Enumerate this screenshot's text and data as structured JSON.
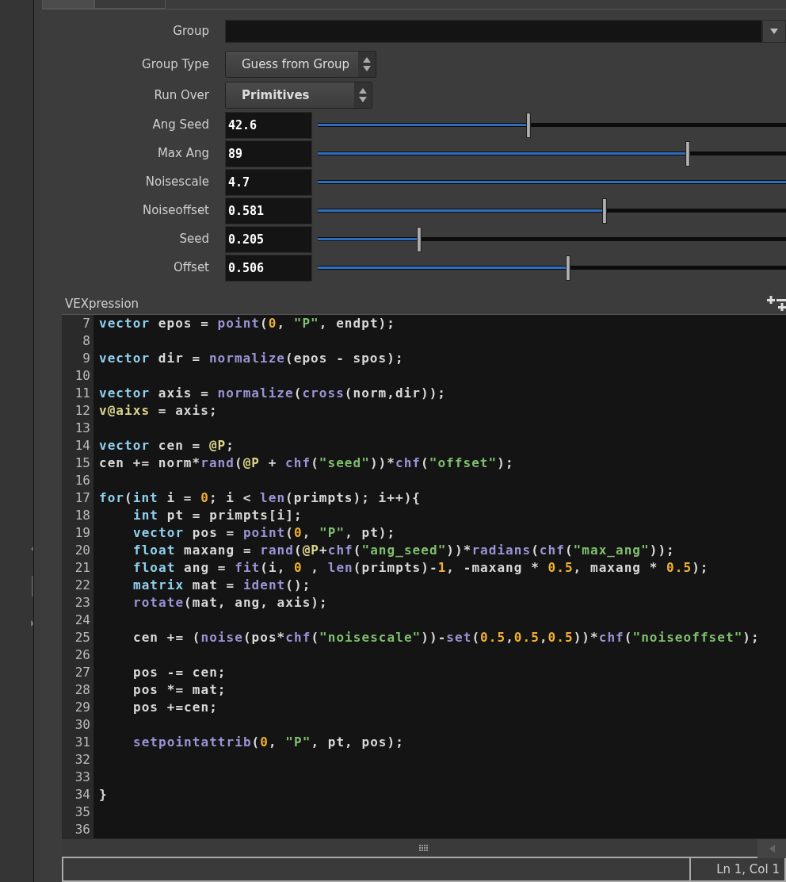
{
  "tabs": [
    {
      "selected": true
    },
    {
      "selected": false
    }
  ],
  "fields": [
    {
      "kind": "text",
      "label": "Group"
    },
    {
      "kind": "menu",
      "label": "Group Type",
      "value": "Guess from Group",
      "bold": false
    },
    {
      "kind": "menu",
      "label": "Run Over",
      "value": "Primitives",
      "bold": true
    },
    {
      "kind": "slider",
      "label": "Ang Seed",
      "value": "42.6",
      "level": 0.45
    },
    {
      "kind": "slider",
      "label": "Max Ang",
      "value": "89",
      "level": 0.79
    },
    {
      "kind": "slider",
      "label": "Noisescale",
      "value": "4.7",
      "level": 1
    },
    {
      "kind": "slider",
      "label": "Noiseoffset",
      "value": "0.581",
      "level": 0.613
    },
    {
      "kind": "slider",
      "label": "Seed",
      "value": "0.205",
      "level": 0.216
    },
    {
      "kind": "slider",
      "label": "Offset",
      "value": "0.506",
      "level": 0.534
    }
  ],
  "editor": {
    "label": "VEXpression",
    "lines": [
      {
        "number": "7",
        "tokens": [
          {
            "kind": "type",
            "text": "vector"
          },
          {
            "kind": "plain",
            "text": " epos = "
          },
          {
            "kind": "func",
            "text": "point"
          },
          {
            "kind": "plain",
            "text": "("
          },
          {
            "kind": "number",
            "text": "0"
          },
          {
            "kind": "plain",
            "text": ", "
          },
          {
            "kind": "string",
            "text": "\"P\""
          },
          {
            "kind": "plain",
            "text": ", endpt);"
          }
        ]
      },
      {
        "number": "8"
      },
      {
        "number": "9",
        "tokens": [
          {
            "kind": "type",
            "text": "vector"
          },
          {
            "kind": "plain",
            "text": " dir = "
          },
          {
            "kind": "func",
            "text": "normalize"
          },
          {
            "kind": "plain",
            "text": "(epos - spos);"
          }
        ]
      },
      {
        "number": "10"
      },
      {
        "number": "11",
        "tokens": [
          {
            "kind": "type",
            "text": "vector"
          },
          {
            "kind": "plain",
            "text": " axis = "
          },
          {
            "kind": "func",
            "text": "normalize"
          },
          {
            "kind": "plain",
            "text": "("
          },
          {
            "kind": "func",
            "text": "cross"
          },
          {
            "kind": "plain",
            "text": "(norm,dir));"
          }
        ]
      },
      {
        "number": "12",
        "tokens": [
          {
            "kind": "attr",
            "text": "v@aixs"
          },
          {
            "kind": "plain",
            "text": " = axis;"
          }
        ]
      },
      {
        "number": "13"
      },
      {
        "number": "14",
        "tokens": [
          {
            "kind": "type",
            "text": "vector"
          },
          {
            "kind": "plain",
            "text": " cen = "
          },
          {
            "kind": "attr",
            "text": "@P"
          },
          {
            "kind": "plain",
            "text": ";"
          }
        ]
      },
      {
        "number": "15",
        "tokens": [
          {
            "kind": "plain",
            "text": "cen += norm*"
          },
          {
            "kind": "func",
            "text": "rand"
          },
          {
            "kind": "plain",
            "text": "("
          },
          {
            "kind": "attr",
            "text": "@P"
          },
          {
            "kind": "plain",
            "text": " + "
          },
          {
            "kind": "func",
            "text": "chf"
          },
          {
            "kind": "plain",
            "text": "("
          },
          {
            "kind": "string",
            "text": "\"seed\""
          },
          {
            "kind": "plain",
            "text": "))*"
          },
          {
            "kind": "func",
            "text": "chf"
          },
          {
            "kind": "plain",
            "text": "("
          },
          {
            "kind": "string",
            "text": "\"offset\""
          },
          {
            "kind": "plain",
            "text": ");"
          }
        ]
      },
      {
        "number": "16"
      },
      {
        "number": "17",
        "tokens": [
          {
            "kind": "type",
            "text": "for"
          },
          {
            "kind": "plain",
            "text": "("
          },
          {
            "kind": "type",
            "text": "int"
          },
          {
            "kind": "plain",
            "text": " i = "
          },
          {
            "kind": "number",
            "text": "0"
          },
          {
            "kind": "plain",
            "text": "; i < "
          },
          {
            "kind": "func",
            "text": "len"
          },
          {
            "kind": "plain",
            "text": "(primpts); i++){"
          }
        ]
      },
      {
        "number": "18",
        "indented": true,
        "tokens": [
          {
            "kind": "type",
            "text": "int"
          },
          {
            "kind": "plain",
            "text": " pt = primpts[i];"
          }
        ]
      },
      {
        "number": "19",
        "indented": true,
        "tokens": [
          {
            "kind": "type",
            "text": "vector"
          },
          {
            "kind": "plain",
            "text": " pos = "
          },
          {
            "kind": "func",
            "text": "point"
          },
          {
            "kind": "plain",
            "text": "("
          },
          {
            "kind": "number",
            "text": "0"
          },
          {
            "kind": "plain",
            "text": ", "
          },
          {
            "kind": "string",
            "text": "\"P\""
          },
          {
            "kind": "plain",
            "text": ", pt);"
          }
        ]
      },
      {
        "number": "20",
        "indented": true,
        "tokens": [
          {
            "kind": "type",
            "text": "float"
          },
          {
            "kind": "plain",
            "text": " maxang = "
          },
          {
            "kind": "func",
            "text": "rand"
          },
          {
            "kind": "plain",
            "text": "("
          },
          {
            "kind": "attr",
            "text": "@P"
          },
          {
            "kind": "plain",
            "text": "+"
          },
          {
            "kind": "func",
            "text": "chf"
          },
          {
            "kind": "plain",
            "text": "("
          },
          {
            "kind": "string",
            "text": "\"ang_seed\""
          },
          {
            "kind": "plain",
            "text": "))*"
          },
          {
            "kind": "func",
            "text": "radians"
          },
          {
            "kind": "plain",
            "text": "("
          },
          {
            "kind": "func",
            "text": "chf"
          },
          {
            "kind": "plain",
            "text": "("
          },
          {
            "kind": "string",
            "text": "\"max_ang\""
          },
          {
            "kind": "plain",
            "text": "));"
          }
        ]
      },
      {
        "number": "21",
        "indented": true,
        "tokens": [
          {
            "kind": "type",
            "text": "float"
          },
          {
            "kind": "plain",
            "text": " ang = "
          },
          {
            "kind": "func",
            "text": "fit"
          },
          {
            "kind": "plain",
            "text": "(i, "
          },
          {
            "kind": "number",
            "text": "0"
          },
          {
            "kind": "plain",
            "text": " , "
          },
          {
            "kind": "func",
            "text": "len"
          },
          {
            "kind": "plain",
            "text": "(primpts)-"
          },
          {
            "kind": "number",
            "text": "1"
          },
          {
            "kind": "plain",
            "text": ", -maxang * "
          },
          {
            "kind": "number",
            "text": "0.5"
          },
          {
            "kind": "plain",
            "text": ", maxang * "
          },
          {
            "kind": "number",
            "text": "0.5"
          },
          {
            "kind": "plain",
            "text": ");"
          }
        ]
      },
      {
        "number": "22",
        "indented": true,
        "tokens": [
          {
            "kind": "type",
            "text": "matrix"
          },
          {
            "kind": "plain",
            "text": " mat = "
          },
          {
            "kind": "func",
            "text": "ident"
          },
          {
            "kind": "plain",
            "text": "();"
          }
        ]
      },
      {
        "number": "23",
        "indented": true,
        "tokens": [
          {
            "kind": "func",
            "text": "rotate"
          },
          {
            "kind": "plain",
            "text": "(mat, ang, axis);"
          }
        ]
      },
      {
        "number": "24"
      },
      {
        "number": "25",
        "indented": true,
        "tokens": [
          {
            "kind": "plain",
            "text": "cen += ("
          },
          {
            "kind": "func",
            "text": "noise"
          },
          {
            "kind": "plain",
            "text": "(pos*"
          },
          {
            "kind": "func",
            "text": "chf"
          },
          {
            "kind": "plain",
            "text": "("
          },
          {
            "kind": "string",
            "text": "\"noisescale\""
          },
          {
            "kind": "plain",
            "text": "))-"
          },
          {
            "kind": "func",
            "text": "set"
          },
          {
            "kind": "plain",
            "text": "("
          },
          {
            "kind": "number",
            "text": "0.5"
          },
          {
            "kind": "plain",
            "text": ","
          },
          {
            "kind": "number",
            "text": "0.5"
          },
          {
            "kind": "plain",
            "text": ","
          },
          {
            "kind": "number",
            "text": "0.5"
          },
          {
            "kind": "plain",
            "text": "))*"
          },
          {
            "kind": "func",
            "text": "chf"
          },
          {
            "kind": "plain",
            "text": "("
          },
          {
            "kind": "string",
            "text": "\"noiseoffset\""
          },
          {
            "kind": "plain",
            "text": ");"
          }
        ]
      },
      {
        "number": "26"
      },
      {
        "number": "27",
        "indented": true,
        "tokens": [
          {
            "kind": "plain",
            "text": "pos -= cen;"
          }
        ]
      },
      {
        "number": "28",
        "indented": true,
        "tokens": [
          {
            "kind": "plain",
            "text": "pos *= mat;"
          }
        ]
      },
      {
        "number": "29",
        "indented": true,
        "tokens": [
          {
            "kind": "plain",
            "text": "pos +=cen;"
          }
        ]
      },
      {
        "number": "30"
      },
      {
        "number": "31",
        "indented": true,
        "tokens": [
          {
            "kind": "func",
            "text": "setpointattrib"
          },
          {
            "kind": "plain",
            "text": "("
          },
          {
            "kind": "number",
            "text": "0"
          },
          {
            "kind": "plain",
            "text": ", "
          },
          {
            "kind": "string",
            "text": "\"P\""
          },
          {
            "kind": "plain",
            "text": ", pt, pos);"
          }
        ]
      },
      {
        "number": "32"
      },
      {
        "number": "33"
      },
      {
        "number": "34",
        "tokens": [
          {
            "kind": "plain",
            "text": "}"
          }
        ]
      },
      {
        "number": "35"
      },
      {
        "number": "36"
      }
    ]
  },
  "status_bar": {
    "position": "Ln 1, Col 1"
  }
}
